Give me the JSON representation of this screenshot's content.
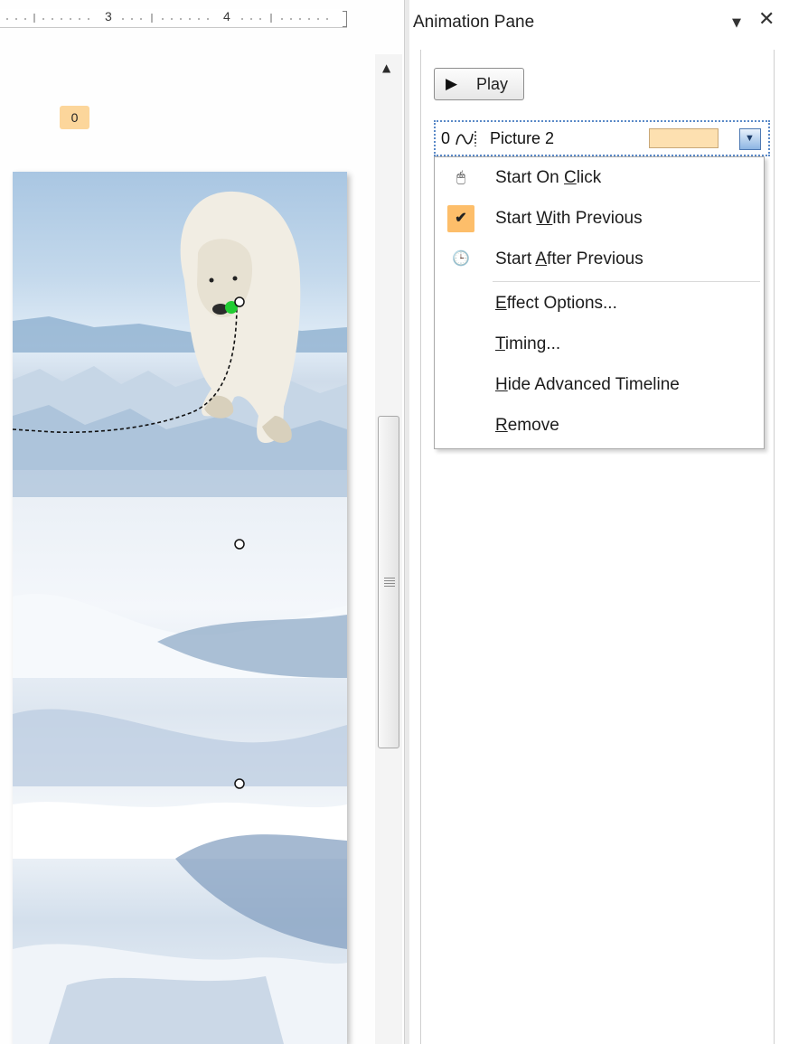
{
  "ruler": {
    "marks": [
      "3",
      "4"
    ]
  },
  "slide": {
    "animation_tag": "0"
  },
  "pane": {
    "title": "Animation Pane",
    "menu_icon": "triangle-down-icon",
    "close_icon": "close-icon",
    "play_button": {
      "label": "Play",
      "icon": "play-triangle-icon"
    },
    "item": {
      "order": "0",
      "icon": "motion-path-icon",
      "label": "Picture 2",
      "timeline_color": "#fde0b0"
    },
    "context_menu": {
      "items": [
        {
          "pre": "Start On ",
          "accel": "C",
          "post": "lick",
          "icon": "mouse-click-icon",
          "checked": false
        },
        {
          "pre": "Start ",
          "accel": "W",
          "post": "ith Previous",
          "icon": "checkmark-icon",
          "checked": true
        },
        {
          "pre": "Start ",
          "accel": "A",
          "post": "fter Previous",
          "icon": "clock-icon",
          "checked": false
        },
        {
          "pre": "",
          "accel": "E",
          "post": "ffect Options...",
          "icon": "",
          "checked": false
        },
        {
          "pre": "",
          "accel": "T",
          "post": "iming...",
          "icon": "",
          "checked": false
        },
        {
          "pre": "",
          "accel": "H",
          "post": "ide Advanced Timeline",
          "icon": "",
          "checked": false
        },
        {
          "pre": "",
          "accel": "R",
          "post": "emove",
          "icon": "",
          "checked": false
        }
      ]
    }
  },
  "colors": {
    "checked_highlight": "#fdbe6a",
    "animation_tag": "#fcd69b",
    "selection_border": "#5a89c7"
  }
}
